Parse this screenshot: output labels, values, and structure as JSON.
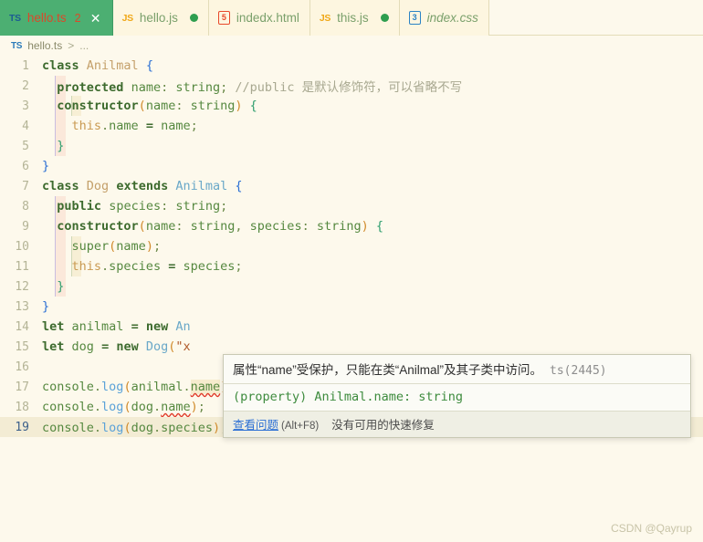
{
  "window": {
    "app": "Visual Studio Code",
    "theme_bg": "#fdf9ec",
    "accent": "#4caf72"
  },
  "tabbar": {
    "tabs": [
      {
        "icon": "typescript-file-icon",
        "icon_text": "TS",
        "label": "hello.ts",
        "badge": "2",
        "close": "✕",
        "active": true,
        "dirty": false,
        "italic": false
      },
      {
        "icon": "javascript-file-icon",
        "icon_text": "JS",
        "label": "hello.js",
        "badge": "",
        "close": "",
        "active": false,
        "dirty": true,
        "italic": false
      },
      {
        "icon": "html-file-icon",
        "icon_text": "5",
        "label": "indedx.html",
        "badge": "",
        "close": "",
        "active": false,
        "dirty": false,
        "italic": false
      },
      {
        "icon": "javascript-file-icon",
        "icon_text": "JS",
        "label": "this.js",
        "badge": "",
        "close": "",
        "active": false,
        "dirty": true,
        "italic": false
      },
      {
        "icon": "css-file-icon",
        "icon_text": "3",
        "label": "index.css",
        "badge": "",
        "close": "",
        "active": false,
        "dirty": false,
        "italic": true
      }
    ]
  },
  "breadcrumb": {
    "icon_text": "TS",
    "file": "hello.ts",
    "separator": ">",
    "ellipsis": "..."
  },
  "editor": {
    "language": "typescript",
    "current_line": 19,
    "lines": [
      {
        "n": "1",
        "text": "class Anilmal {"
      },
      {
        "n": "2",
        "text": "  protected name: string; //public 是默认修饰符，可以省略不写"
      },
      {
        "n": "3",
        "text": "  constructor(name: string) {"
      },
      {
        "n": "4",
        "text": "    this.name = name;"
      },
      {
        "n": "5",
        "text": "  }"
      },
      {
        "n": "6",
        "text": "}"
      },
      {
        "n": "7",
        "text": "class Dog extends Anilmal {"
      },
      {
        "n": "8",
        "text": "  public species: string;"
      },
      {
        "n": "9",
        "text": "  constructor(name: string, species: string) {"
      },
      {
        "n": "10",
        "text": "    super(name);"
      },
      {
        "n": "11",
        "text": "    this.species = species;"
      },
      {
        "n": "12",
        "text": "  }"
      },
      {
        "n": "13",
        "text": "}"
      },
      {
        "n": "14",
        "text": "let anilmal = new An"
      },
      {
        "n": "15",
        "text": "let dog = new Dog(\"x"
      },
      {
        "n": "16",
        "text": ""
      },
      {
        "n": "17",
        "text": "console.log(anilmal.name);"
      },
      {
        "n": "18",
        "text": "console.log(dog.name);"
      },
      {
        "n": "19",
        "text": "console.log(dog.species);"
      }
    ]
  },
  "tooltip": {
    "message": "属性“name”受保护，只能在类“Anilmal”及其子类中访问。",
    "code": "ts(2445)",
    "signature_kind": "(property)",
    "signature": "Anilmal.name: string",
    "link": "查看问题",
    "shortcut": "(Alt+F8)",
    "note": "没有可用的快速修复"
  },
  "watermark": {
    "text": "CSDN @Qayrup"
  }
}
